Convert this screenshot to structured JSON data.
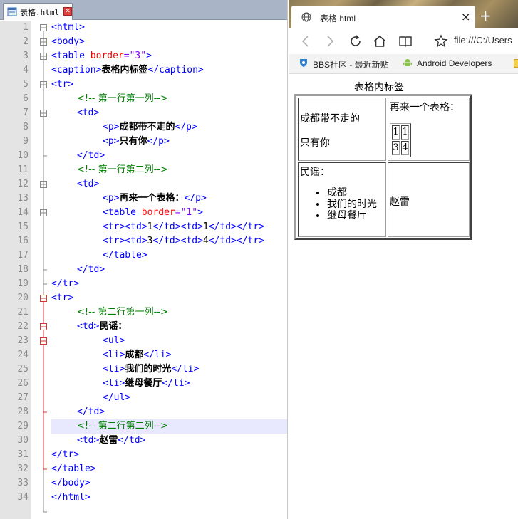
{
  "editor": {
    "tab_label": "表格.html",
    "line_numbers": [
      "1",
      "2",
      "3",
      "4",
      "5",
      "6",
      "7",
      "8",
      "9",
      "10",
      "11",
      "12",
      "13",
      "14",
      "15",
      "16",
      "17",
      "18",
      "19",
      "20",
      "21",
      "22",
      "23",
      "24",
      "25",
      "26",
      "27",
      "28",
      "29",
      "30",
      "31",
      "32",
      "33",
      "34"
    ],
    "lines": {
      "l1": "<html>",
      "l2": "<body>",
      "l3a": "<table ",
      "l3b": "border",
      "l3c": "=\"3\"",
      "l3d": ">",
      "l4a": "<caption>",
      "l4b": "表格内标签",
      "l4c": "</caption>",
      "l5": "<tr>",
      "l6": "<!-- 第一行第一列-->",
      "l7": "<td>",
      "l8a": "<p>",
      "l8b": "成都带不走的",
      "l8c": "</p>",
      "l9a": "<p>",
      "l9b": "只有你",
      "l9c": "</p>",
      "l10": "</td>",
      "l11": "<!-- 第一行第二列-->",
      "l12": "<td>",
      "l13a": "<p>",
      "l13b": "再来一个表格：",
      "l13c": "</p>",
      "l14a": "<table ",
      "l14b": "border",
      "l14c": "=\"1\"",
      "l14d": ">",
      "l15a": "<tr><td>",
      "l15b": "1",
      "l15c": "</td><td>",
      "l15d": "1",
      "l15e": "</td></tr>",
      "l16a": "<tr><td>",
      "l16b": "3",
      "l16c": "</td><td>",
      "l16d": "4",
      "l16e": "</td></tr>",
      "l17": "</table>",
      "l18": "</td>",
      "l19": "</tr>",
      "l20": "<tr>",
      "l21": "<!-- 第二行第一列-->",
      "l22a": "<td>",
      "l22b": "民谣：",
      "l23": "<ul>",
      "l24a": "<li>",
      "l24b": "成都",
      "l24c": "</li>",
      "l25a": "<li>",
      "l25b": "我们的时光",
      "l25c": "</li>",
      "l26a": "<li>",
      "l26b": "继母餐厅",
      "l26c": "</li>",
      "l27": "</ul>",
      "l28": "</td>",
      "l29": "<!-- 第二行第二列-->",
      "l30a": "<td>",
      "l30b": "赵雷",
      "l30c": "</td>",
      "l31": "</tr>",
      "l32": "</table>",
      "l33": "</body>",
      "l34": "</html>"
    }
  },
  "browser": {
    "tab_title": "表格.html",
    "tab_close": "×",
    "new_tab": "+",
    "address": "file:///C:/Users",
    "favorites": [
      "BBS社区 - 最近新贴",
      "Android Developers"
    ],
    "page": {
      "caption": "表格内标签",
      "cell_1_1": [
        "成都带不走的",
        "只有你"
      ],
      "cell_1_2_text": "再来一个表格：",
      "inner_table": [
        [
          "1",
          "1"
        ],
        [
          "3",
          "4"
        ]
      ],
      "cell_2_1_text": "民谣：",
      "cell_2_1_list": [
        "成都",
        "我们的时光",
        "继母餐厅"
      ],
      "cell_2_2": "赵雷"
    }
  },
  "colors": {
    "tag": "#0000ff",
    "attribute": "#ff0000",
    "attr_value": "#8000ff",
    "comment": "#008000",
    "current_line": "#e8e8ff"
  }
}
